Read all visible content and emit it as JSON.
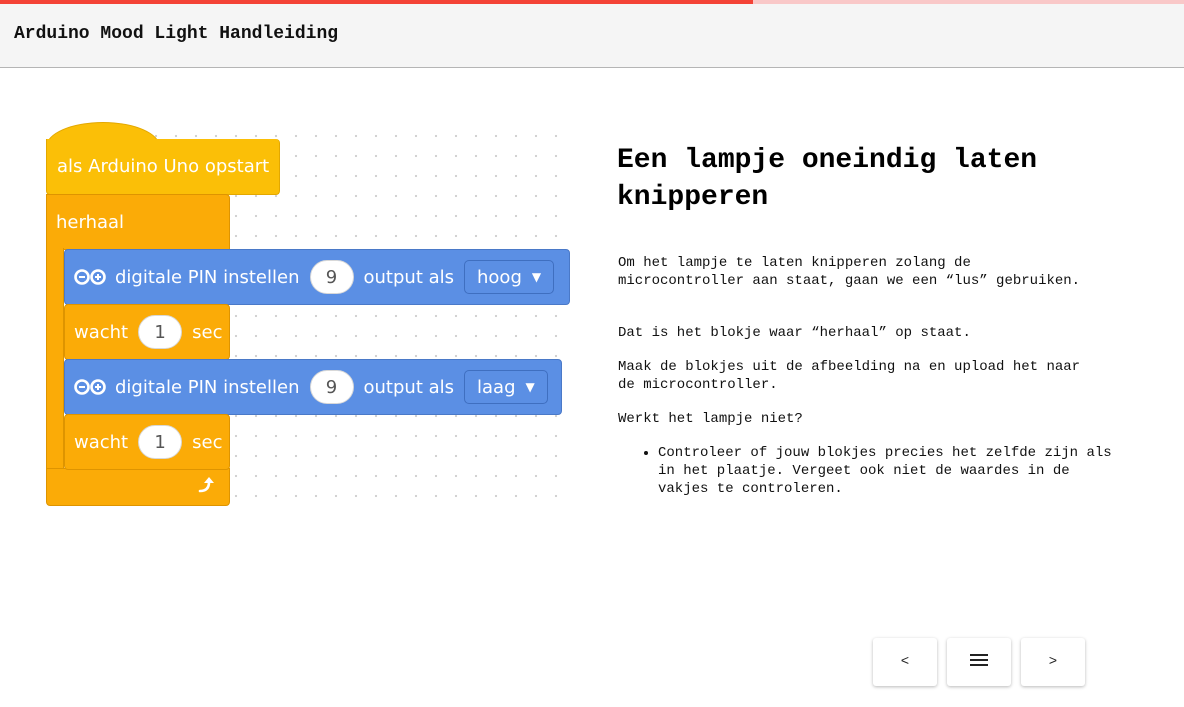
{
  "header": {
    "title": "Arduino Mood Light Handleiding"
  },
  "progress": {
    "fraction": 0.636
  },
  "blocks": {
    "start": {
      "label": "als Arduino Uno opstart"
    },
    "repeat": {
      "label": "herhaal"
    },
    "pin1": {
      "label": "digitale PIN instellen",
      "pin": "9",
      "mode_label": "output als",
      "mode_value": "hoog"
    },
    "wait1": {
      "label": "wacht",
      "value": "1",
      "unit": "sec"
    },
    "pin2": {
      "label": "digitale PIN instellen",
      "pin": "9",
      "mode_label": "output als",
      "mode_value": "laag"
    },
    "wait2": {
      "label": "wacht",
      "value": "1",
      "unit": "sec"
    }
  },
  "content": {
    "heading": "Een lampje oneindig laten knipperen",
    "p1": "Om het lampje te laten knipperen zolang de microcontroller aan staat, gaan we een “lus” gebruiken.",
    "p2": "Dat is het blokje waar “herhaal” op staat.",
    "p3": "Maak de blokjes uit de afbeelding na en upload het naar de microcontroller.",
    "p4": "Werkt het lampje niet?",
    "bullets": [
      "Controleer of jouw blokjes precies het zelfde zijn als in het plaatje. Vergeet ook niet de waardes in de vakjes te controleren."
    ]
  },
  "nav": {
    "prev_label": "<",
    "next_label": ">"
  },
  "icons": {
    "menu": "menu-icon",
    "arduino": "arduino-logo-icon",
    "loop": "loop-arrow-icon"
  },
  "colors": {
    "accent": "#f44336",
    "block_hat": "#fbbf07",
    "block_control": "#fbab07",
    "block_pin": "#5b8fe4"
  }
}
